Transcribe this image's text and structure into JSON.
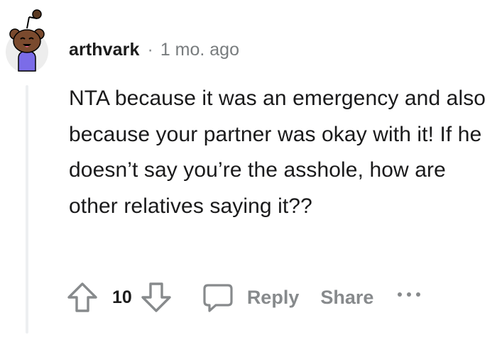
{
  "comment": {
    "author": "arthvark",
    "separator": "·",
    "timestamp": "1 mo. ago",
    "body": "NTA because it was an emergency and also because your partner was okay with it! If he doesn’t say you’re the asshole, how are other relatives saying it??"
  },
  "actions": {
    "vote_count": "10",
    "reply_label": "Reply",
    "share_label": "Share"
  },
  "icons": {
    "avatar": "snoo-avatar-icon",
    "upvote": "upvote-arrow-icon",
    "downvote": "downvote-arrow-icon",
    "reply": "speech-bubble-icon",
    "more": "ellipsis-icon"
  },
  "colors": {
    "avatar_skin": "#7a4a2e",
    "avatar_shirt": "#7b6ce8",
    "avatar_bg": "#ededed",
    "muted_gray": "#878a8c",
    "thread_line": "#edeff1"
  }
}
